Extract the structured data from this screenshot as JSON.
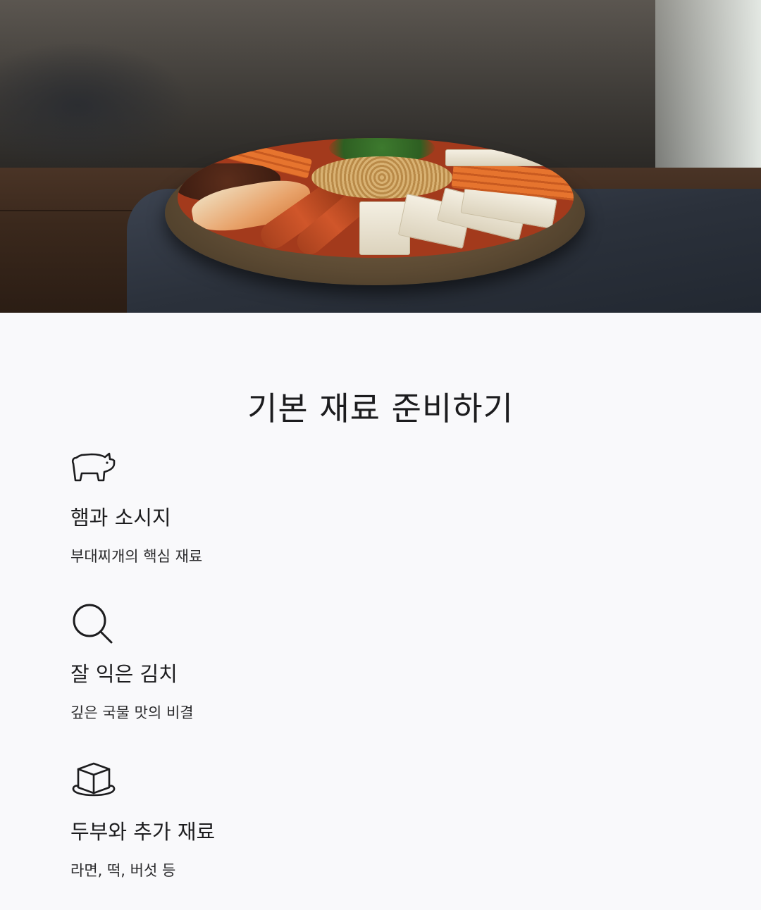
{
  "hero": {
    "image": "budae-jjigae-ingredients-photo"
  },
  "section": {
    "title": "기본 재료 준비하기"
  },
  "items": [
    {
      "icon": "pig-icon",
      "title": "햄과 소시지",
      "subtitle": "부대찌개의 핵심 재료"
    },
    {
      "icon": "search-icon",
      "title": "잘 익은 김치",
      "subtitle": "깊은 국물 맛의 비결"
    },
    {
      "icon": "cube-icon",
      "title": "두부와 추가 재료",
      "subtitle": "라면, 떡, 버섯 등"
    }
  ],
  "colors": {
    "background": "#f9f9fb",
    "text": "#1c1c1e"
  }
}
